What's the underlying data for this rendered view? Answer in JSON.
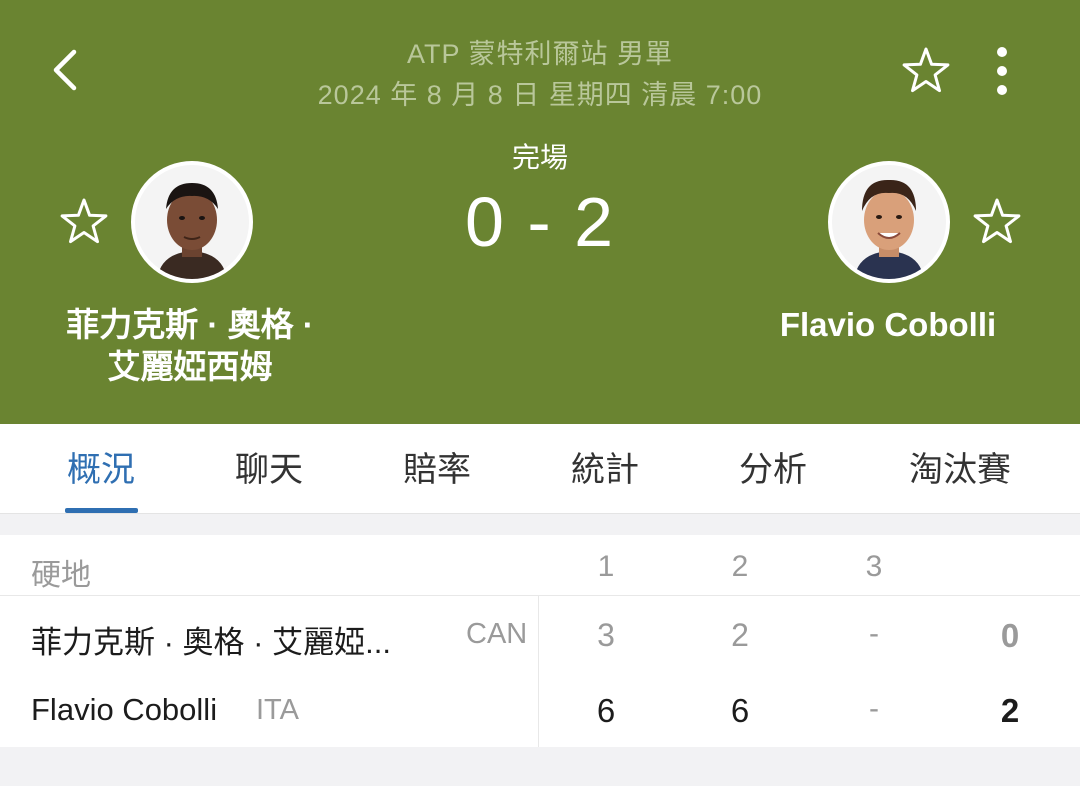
{
  "header": {
    "event_title": "ATP 蒙特利爾站 男單",
    "event_date": "2024 年 8 月 8 日 星期四 清晨 7:00",
    "status": "完場",
    "score": "0 - 2",
    "icons": {
      "back": "chevron-left-icon",
      "favorite": "star-outline-icon",
      "more": "more-vertical-icon"
    },
    "colors": {
      "background": "#6a8431",
      "subtle_text": "#b9c79a"
    }
  },
  "player1": {
    "name_line1": "菲力克斯 · 奧格 ·",
    "name_line2": "艾麗婭西姆"
  },
  "player2": {
    "name": "Flavio Cobolli"
  },
  "tabs": [
    {
      "label": "概況",
      "active": true
    },
    {
      "label": "聊天",
      "active": false
    },
    {
      "label": "賠率",
      "active": false
    },
    {
      "label": "統計",
      "active": false
    },
    {
      "label": "分析",
      "active": false
    },
    {
      "label": "淘汰賽",
      "active": false
    }
  ],
  "tab_active_color": "#2f6fb2",
  "scorecard": {
    "surface": "硬地",
    "set_headers": [
      "1",
      "2",
      "3"
    ],
    "rows": [
      {
        "name": "菲力克斯 · 奧格 · 艾麗婭...",
        "country": "CAN",
        "sets": [
          "3",
          "2",
          "-"
        ],
        "total": "0"
      },
      {
        "name": "Flavio Cobolli",
        "country": "ITA",
        "sets": [
          "6",
          "6",
          "-"
        ],
        "total": "2"
      }
    ]
  }
}
